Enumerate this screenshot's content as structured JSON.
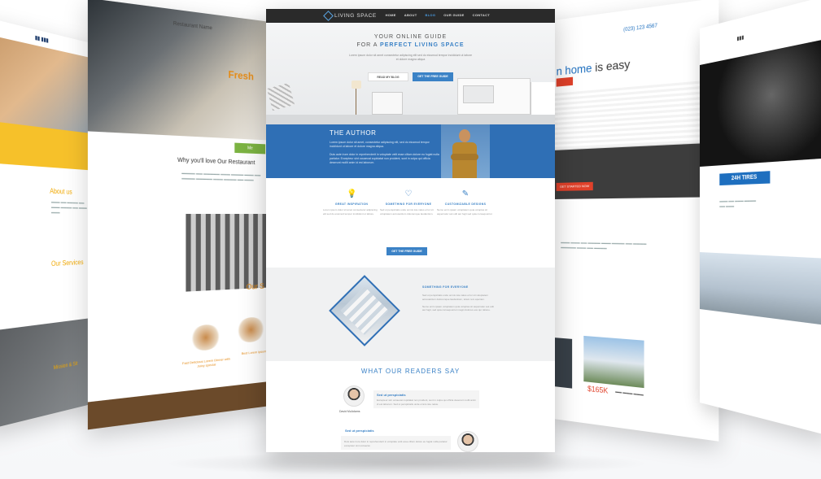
{
  "main": {
    "logo": "LIVING SPACE",
    "nav": [
      "HOME",
      "ABOUT",
      "BLOG",
      "OUR GUIDE",
      "CONTACT"
    ],
    "nav_active_index": 2,
    "hero": {
      "kicker": "YOUR ONLINE GUIDE",
      "title_prefix": "FOR A",
      "title_highlight": "PERFECT LIVING SPACE",
      "subtitle": "Lorem ipsum dolor sit amet consectetur adipiscing elit sed do eiusmod tempor incididunt ut labore et dolore magna aliqua",
      "btn_outline": "READ MY BLOG",
      "btn_blue": "GET THE FREE GUIDE"
    },
    "author": {
      "title": "THE AUTHOR",
      "text_1": "Lorem ipsum dolor sit amet, consectetur adipiscing elit, sed do eiusmod tempor incididunt ut labore et dolore magna aliqua.",
      "text_2": "Duis aute irure dolor in reprehenderit in voluptate velit esse cillum dolore eu fugiat nulla pariatur. Excepteur sint occaecat cupidatat non proident, sunt in culpa qui officia deserunt mollit anim id est laborum."
    },
    "features": [
      {
        "icon": "lightbulb-icon",
        "glyph": "💡",
        "title": "GREAT INSPIRATION",
        "desc": "Lorem ipsum dolor sit amet consectetur adipiscing elit sed do eiusmod tempor incididunt ut labore."
      },
      {
        "icon": "heart-icon",
        "glyph": "♡",
        "title": "SOMETHING FOR EVERYONE",
        "desc": "Sed ut perspiciatis unde omnis iste natus error sit voluptatem accusantium doloremque laudantium."
      },
      {
        "icon": "pencil-icon",
        "glyph": "✎",
        "title": "CUSTOMIZABLE DESIGNS",
        "desc": "Nemo enim ipsam voluptatem quia voluptas sit aspernatur aut odit aut fugit sed quia consequuntur."
      }
    ],
    "features_btn": "GET THE FREE GUIDE",
    "something": {
      "title": "SOMETHING FOR EVERYONE",
      "text_1": "Sed ut perspiciatis unde omnis iste natus error sit voluptatem accusantium doloremque laudantium, totam rem aperiam.",
      "text_2": "Nemo enim ipsam voluptatem quia voluptas sit aspernatur aut odit aut fugit, sed quia consequuntur magni dolores eos qui ratione."
    },
    "readers": {
      "title": "WHAT OUR READERS SAY",
      "quote_1_title": "Sed ut perspiciatis",
      "quote_1_text": "Excepteur sint occaecat cupidatat non proident, sunt in culpa qui officia deserunt mollit anim id est laborum. Sed ut perspiciatis unde omnis iste natus.",
      "quote_1_name": "David McAdams",
      "quote_2_title": "Sed ut perspiciatis",
      "quote_2_text": "Duis aute irure dolor in reprehenderit in voluptate velit esse cillum dolore eu fugiat nulla pariatur excepteur sint occaecat."
    }
  },
  "restaurant": {
    "brand": "Restaurant Name",
    "hero_title": "The Secret to",
    "hero_highlight": "Fresh",
    "why_title": "Why you'll love Our Restaurant",
    "menu_heading": "Our S",
    "caption_1": "Fast Delicious Lorem Dinner with Juicy special",
    "caption_2": "Best Lorem Ipsum",
    "green_btn": "Me"
  },
  "construction": {
    "about": "About us",
    "services": "Our Services",
    "footer_label": "Mission & Sit"
  },
  "realestate": {
    "phone": "(023) 123 4567",
    "headline_prefix": "n home",
    "headline_suffix": "is easy",
    "price": "$165K",
    "form_button": "GET STARTED NOW"
  },
  "tires": {
    "tag": "24H TIRES"
  }
}
